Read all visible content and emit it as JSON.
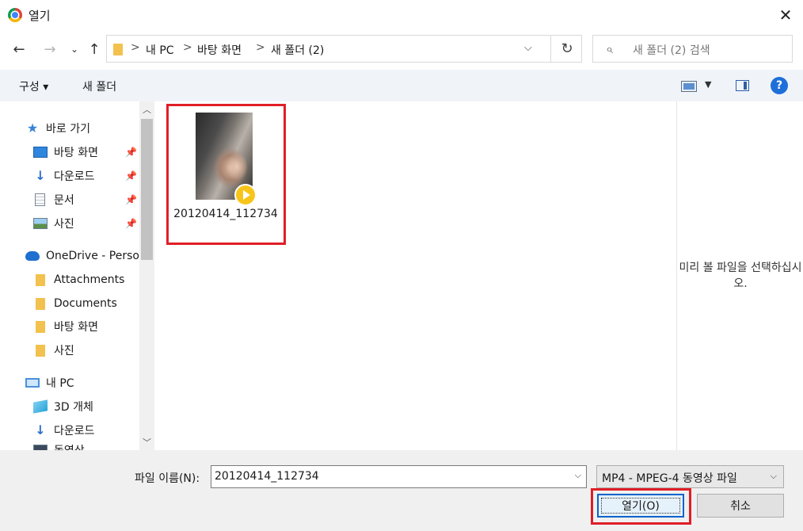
{
  "window": {
    "title": "열기"
  },
  "address": {
    "crumbs": [
      "내 PC",
      "바탕 화면",
      "새 폴더 (2)"
    ],
    "separator": ">"
  },
  "search": {
    "placeholder": "새 폴더 (2) 검색"
  },
  "toolbar": {
    "organize": "구성 ▾",
    "new_folder": "새 폴더"
  },
  "sidebar": {
    "items": [
      {
        "label": "바로 가기",
        "icon": "star-icon"
      },
      {
        "label": "바탕 화면",
        "icon": "desktop-icon",
        "pinned": true
      },
      {
        "label": "다운로드",
        "icon": "download-icon",
        "pinned": true
      },
      {
        "label": "문서",
        "icon": "document-icon",
        "pinned": true
      },
      {
        "label": "사진",
        "icon": "pictures-icon",
        "pinned": true
      },
      {
        "label": "OneDrive - Person",
        "icon": "onedrive-icon"
      },
      {
        "label": "Attachments",
        "icon": "folder-icon"
      },
      {
        "label": "Documents",
        "icon": "folder-icon"
      },
      {
        "label": "바탕 화면",
        "icon": "folder-icon"
      },
      {
        "label": "사진",
        "icon": "folder-icon"
      },
      {
        "label": "내 PC",
        "icon": "pc-icon"
      },
      {
        "label": "3D 개체",
        "icon": "3d-objects-icon"
      },
      {
        "label": "다운로드",
        "icon": "download-icon"
      },
      {
        "label": "동영상",
        "icon": "video-icon"
      }
    ]
  },
  "files": [
    {
      "name": "20120414_112734",
      "type": "video"
    }
  ],
  "preview": {
    "message": "미리 볼 파일을 선택하십시오."
  },
  "footer": {
    "filename_label": "파일 이름(N):",
    "filename_value": "20120414_112734",
    "filetype_value": "MP4 - MPEG-4 동영상 파일",
    "open_label": "열기(O)",
    "cancel_label": "취소"
  },
  "colors": {
    "highlight": "#e01e26",
    "accent": "#0a64c9"
  }
}
